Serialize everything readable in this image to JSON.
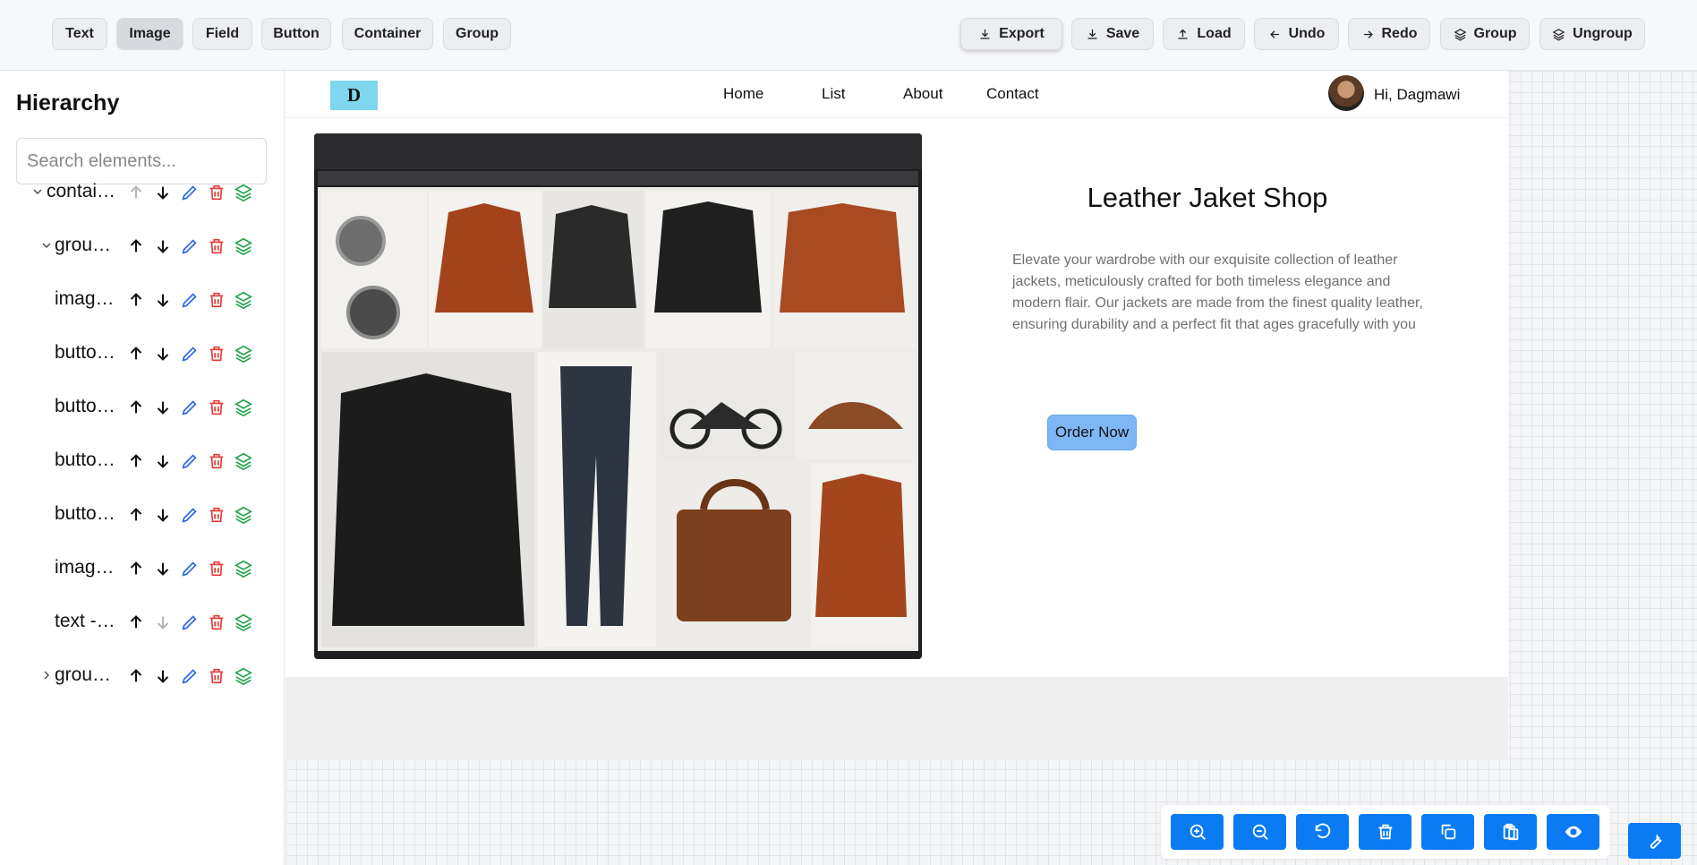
{
  "toolbar": {
    "left": [
      "Text",
      "Image",
      "Field",
      "Button",
      "Container",
      "Group"
    ],
    "right": [
      "Export",
      "Save",
      "Load",
      "Undo",
      "Redo",
      "Group",
      "Ungroup"
    ]
  },
  "sidebar": {
    "title": "Hierarchy",
    "search_placeholder": "Search elements...",
    "items": [
      {
        "label": "contai…",
        "chevron": "down",
        "up_enabled": false,
        "down_enabled": true
      },
      {
        "label": "grou…",
        "chevron": "down",
        "up_enabled": true,
        "down_enabled": true
      },
      {
        "label": "imag…",
        "chevron": "",
        "up_enabled": true,
        "down_enabled": true
      },
      {
        "label": "butto…",
        "chevron": "",
        "up_enabled": true,
        "down_enabled": true
      },
      {
        "label": "butto…",
        "chevron": "",
        "up_enabled": true,
        "down_enabled": true
      },
      {
        "label": "butto…",
        "chevron": "",
        "up_enabled": true,
        "down_enabled": true
      },
      {
        "label": "butto…",
        "chevron": "",
        "up_enabled": true,
        "down_enabled": true
      },
      {
        "label": "imag…",
        "chevron": "",
        "up_enabled": true,
        "down_enabled": true
      },
      {
        "label": "text -…",
        "chevron": "",
        "up_enabled": true,
        "down_enabled": false
      },
      {
        "label": "grou…",
        "chevron": "right",
        "up_enabled": true,
        "down_enabled": true
      }
    ]
  },
  "preview": {
    "logo": "D",
    "nav": [
      "Home",
      "List",
      "About",
      "Contact"
    ],
    "greeting": "Hi, Dagmawi",
    "title": "Leather Jaket Shop",
    "description": "Elevate your wardrobe with our exquisite collection of leather jackets, meticulously crafted for both timeless elegance and modern flair. Our jackets are made from the finest quality leather, ensuring durability and a perfect fit that ages gracefully with you",
    "cta": "Order Now"
  },
  "bottom_tools": [
    "zoom-in",
    "zoom-out",
    "reset",
    "delete",
    "duplicate",
    "paste",
    "preview"
  ],
  "colors": {
    "accent": "#0a7bf2",
    "cta": "#7fb6f5",
    "delete": "#e53935",
    "layers": "#22a34a",
    "edit": "#2563eb"
  }
}
